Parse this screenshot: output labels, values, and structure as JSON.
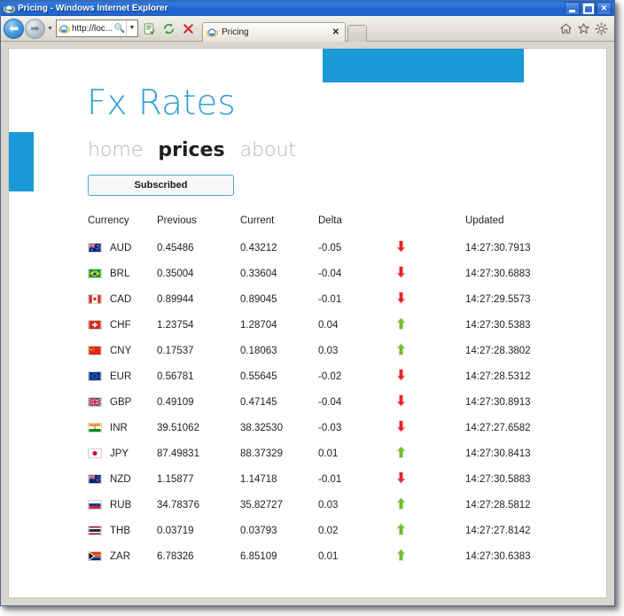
{
  "window": {
    "title": "Pricing - Windows Internet Explorer",
    "minimize_label": "Minimize",
    "maximize_label": "Maximize",
    "close_label": "Close"
  },
  "toolbar": {
    "back_label": "Back",
    "forward_label": "Forward",
    "history_label": "Recent Pages",
    "address_value": "http://loc...",
    "address_placeholder": "http://loc...",
    "search_label": "Search",
    "address_dropdown_label": "Address dropdown",
    "compat_label": "Compatibility View",
    "refresh_label": "Refresh",
    "stop_label": "Stop",
    "home_label": "Home",
    "favorites_label": "Favorites",
    "tools_label": "Tools"
  },
  "tabs": [
    {
      "label": "Pricing",
      "close_label": "Close Tab"
    }
  ],
  "new_tab_label": "New Tab",
  "site": {
    "title": "Fx Rates",
    "accent_color": "#1b9ad8",
    "nav": [
      {
        "label": "home",
        "active": false
      },
      {
        "label": "prices",
        "active": true
      },
      {
        "label": "about",
        "active": false
      }
    ],
    "subscribe_button": "Subscribed"
  },
  "table": {
    "columns": [
      "Currency",
      "Previous",
      "Current",
      "Delta",
      "",
      "Updated"
    ],
    "up_color": "#6fbe2a",
    "down_color": "#e8252a",
    "rows": [
      {
        "code": "AUD",
        "flag": "au",
        "previous": "0.45486",
        "current": "0.43212",
        "delta": "-0.05",
        "direction": "down",
        "updated": "14:27:30.7913"
      },
      {
        "code": "BRL",
        "flag": "br",
        "previous": "0.35004",
        "current": "0.33604",
        "delta": "-0.04",
        "direction": "down",
        "updated": "14:27:30.6883"
      },
      {
        "code": "CAD",
        "flag": "ca",
        "previous": "0.89944",
        "current": "0.89045",
        "delta": "-0.01",
        "direction": "down",
        "updated": "14:27:29.5573"
      },
      {
        "code": "CHF",
        "flag": "ch",
        "previous": "1.23754",
        "current": "1.28704",
        "delta": "0.04",
        "direction": "up",
        "updated": "14:27:30.5383"
      },
      {
        "code": "CNY",
        "flag": "cn",
        "previous": "0.17537",
        "current": "0.18063",
        "delta": "0.03",
        "direction": "up",
        "updated": "14:27:28.3802"
      },
      {
        "code": "EUR",
        "flag": "eu",
        "previous": "0.56781",
        "current": "0.55645",
        "delta": "-0.02",
        "direction": "down",
        "updated": "14:27:28.5312"
      },
      {
        "code": "GBP",
        "flag": "gb",
        "previous": "0.49109",
        "current": "0.47145",
        "delta": "-0.04",
        "direction": "down",
        "updated": "14:27:30.8913"
      },
      {
        "code": "INR",
        "flag": "in",
        "previous": "39.51062",
        "current": "38.32530",
        "delta": "-0.03",
        "direction": "down",
        "updated": "14:27:27.6582"
      },
      {
        "code": "JPY",
        "flag": "jp",
        "previous": "87.49831",
        "current": "88.37329",
        "delta": "0.01",
        "direction": "up",
        "updated": "14:27:30.8413"
      },
      {
        "code": "NZD",
        "flag": "nz",
        "previous": "1.15877",
        "current": "1.14718",
        "delta": "-0.01",
        "direction": "down",
        "updated": "14:27:30.5883"
      },
      {
        "code": "RUB",
        "flag": "ru",
        "previous": "34.78376",
        "current": "35.82727",
        "delta": "0.03",
        "direction": "up",
        "updated": "14:27:28.5812"
      },
      {
        "code": "THB",
        "flag": "th",
        "previous": "0.03719",
        "current": "0.03793",
        "delta": "0.02",
        "direction": "up",
        "updated": "14:27:27.8142"
      },
      {
        "code": "ZAR",
        "flag": "za",
        "previous": "6.78326",
        "current": "6.85109",
        "delta": "0.01",
        "direction": "up",
        "updated": "14:27:30.6383"
      }
    ]
  }
}
